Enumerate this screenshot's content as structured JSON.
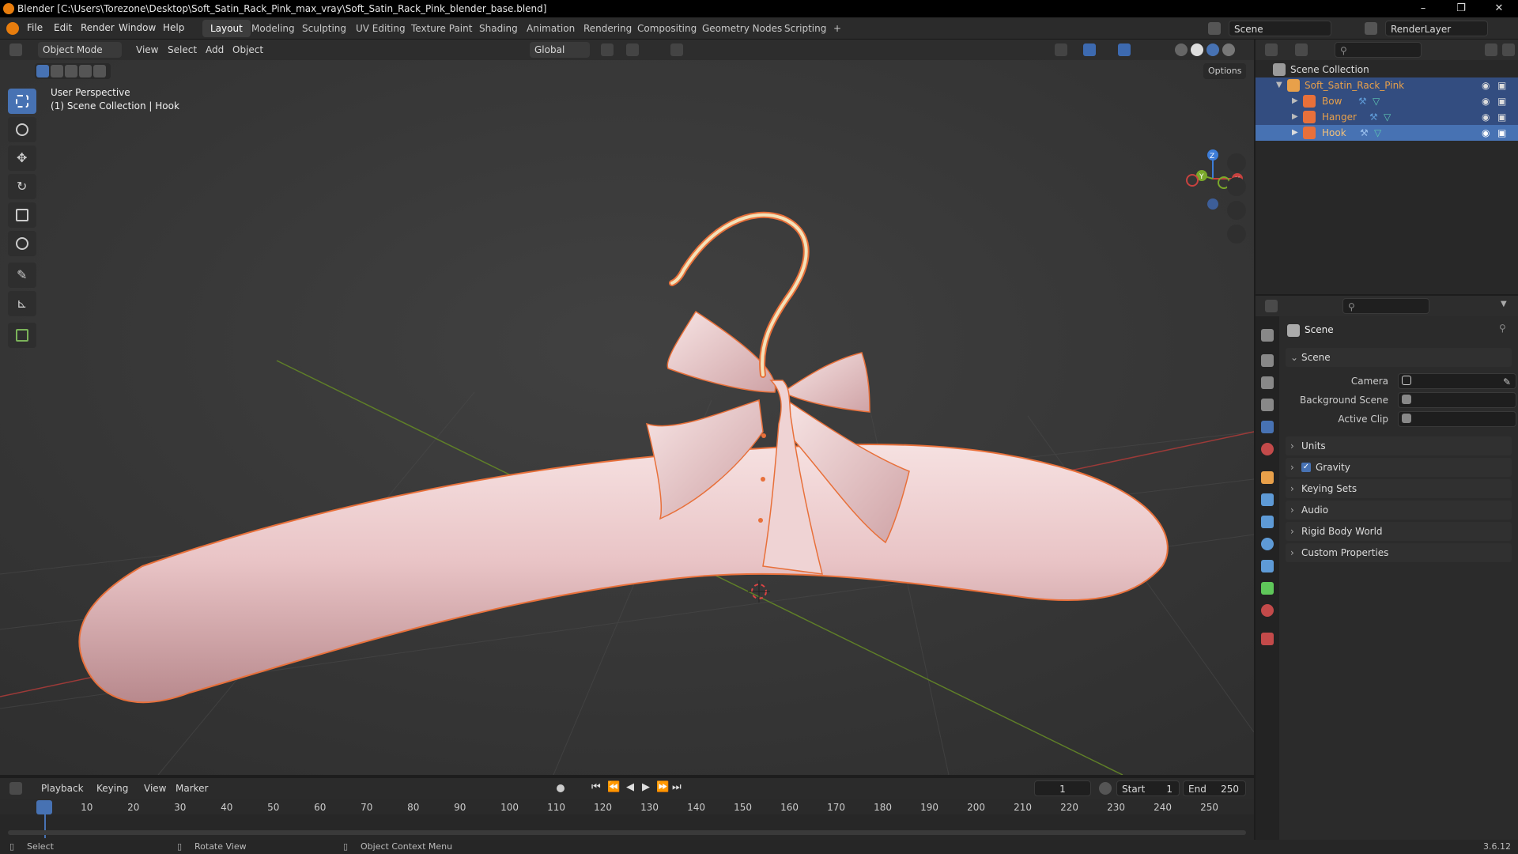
{
  "window": {
    "title": "Blender [C:\\Users\\Torezone\\Desktop\\Soft_Satin_Rack_Pink_max_vray\\Soft_Satin_Rack_Pink_blender_base.blend]",
    "minimize": "–",
    "maximize": "❐",
    "close": "✕"
  },
  "menu": [
    "File",
    "Edit",
    "Render",
    "Window",
    "Help"
  ],
  "workspaces": [
    "Layout",
    "Modeling",
    "Sculpting",
    "UV Editing",
    "Texture Paint",
    "Shading",
    "Animation",
    "Rendering",
    "Compositing",
    "Geometry Nodes",
    "Scripting",
    "+"
  ],
  "active_workspace": "Layout",
  "scene_field": "Scene",
  "renderlayer_field": "RenderLayer",
  "viewport_header": {
    "mode": "Object Mode",
    "menus": [
      "View",
      "Select",
      "Add",
      "Object"
    ],
    "transform_orientation": "Global",
    "options": "Options"
  },
  "viewport_overlay": {
    "line1": "User Perspective",
    "line2": "(1) Scene Collection | Hook"
  },
  "gizmo": {
    "z": "Z",
    "y": "Y",
    "x": "X"
  },
  "outliner": {
    "root": "Scene Collection",
    "collection": "Soft_Satin_Rack_Pink",
    "objects": [
      "Bow",
      "Hanger",
      "Hook"
    ],
    "selected": "Hook"
  },
  "properties": {
    "context": "Scene",
    "panel_scene": "Scene",
    "fields": [
      {
        "label": "Camera"
      },
      {
        "label": "Background Scene"
      },
      {
        "label": "Active Clip"
      }
    ],
    "collapsed_panels": [
      "Units",
      "Gravity",
      "Keying Sets",
      "Audio",
      "Rigid Body World",
      "Custom Properties"
    ],
    "gravity_checked": true
  },
  "timeline": {
    "menus": [
      "Playback",
      "Keying",
      "View",
      "Marker"
    ],
    "current_frame": "1",
    "start_label": "Start",
    "start": "1",
    "end_label": "End",
    "end": "250",
    "ticks": [
      "1",
      "10",
      "20",
      "30",
      "40",
      "50",
      "60",
      "70",
      "80",
      "90",
      "100",
      "110",
      "120",
      "130",
      "140",
      "150",
      "160",
      "170",
      "180",
      "190",
      "200",
      "210",
      "220",
      "230",
      "240",
      "250"
    ]
  },
  "statusbar": {
    "select": "Select",
    "rotate": "Rotate View",
    "context_menu": "Object Context Menu",
    "version": "3.6.12"
  },
  "colors": {
    "accent": "#4772b3",
    "selection_outline": "#e8703a",
    "axis_x": "#c8423f",
    "axis_y": "#7aa82a",
    "axis_z": "#3d7dd8",
    "object_name": "#e8a04a"
  }
}
